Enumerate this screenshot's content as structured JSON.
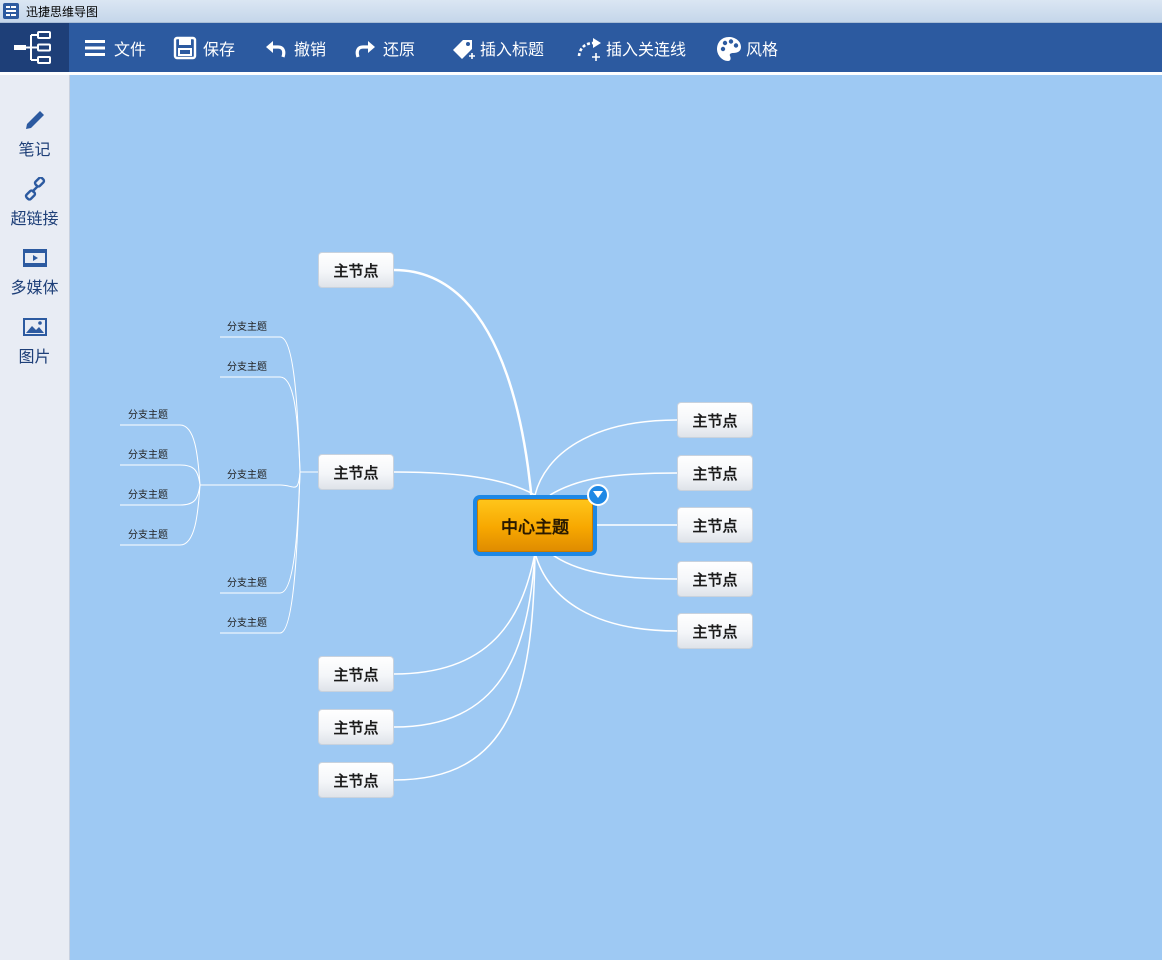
{
  "window": {
    "title": "迅捷思维导图"
  },
  "toolbar": {
    "items": [
      {
        "label": "文件",
        "icon": "menu-icon"
      },
      {
        "label": "保存",
        "icon": "save-icon"
      },
      {
        "label": "撤销",
        "icon": "undo-icon"
      },
      {
        "label": "还原",
        "icon": "redo-icon"
      },
      {
        "label": "插入标题",
        "icon": "tag-plus-icon"
      },
      {
        "label": "插入关连线",
        "icon": "relation-line-icon"
      },
      {
        "label": "风格",
        "icon": "palette-icon"
      }
    ]
  },
  "sidebar": {
    "items": [
      {
        "label": "笔记",
        "icon": "pencil-icon"
      },
      {
        "label": "超链接",
        "icon": "link-icon"
      },
      {
        "label": "多媒体",
        "icon": "film-icon"
      },
      {
        "label": "图片",
        "icon": "image-icon"
      }
    ]
  },
  "mindmap": {
    "center": "中心主题",
    "main_node_label": "主节点",
    "sub_topic_label": "分支主题",
    "left_main_nodes": [
      "主节点",
      "主节点",
      "主节点",
      "主节点",
      "主节点"
    ],
    "right_main_nodes": [
      "主节点",
      "主节点",
      "主节点",
      "主节点",
      "主节点"
    ],
    "branch_topics": [
      "分支主题",
      "分支主题",
      "分支主题",
      "分支主题",
      "分支主题",
      "分支主题",
      "分支主题",
      "分支主题",
      "分支主题"
    ]
  },
  "colors": {
    "toolbar": "#2c5aa0",
    "canvas": "#9ec9f3",
    "center_node": "#f7a700",
    "center_border": "#1e88e5"
  }
}
